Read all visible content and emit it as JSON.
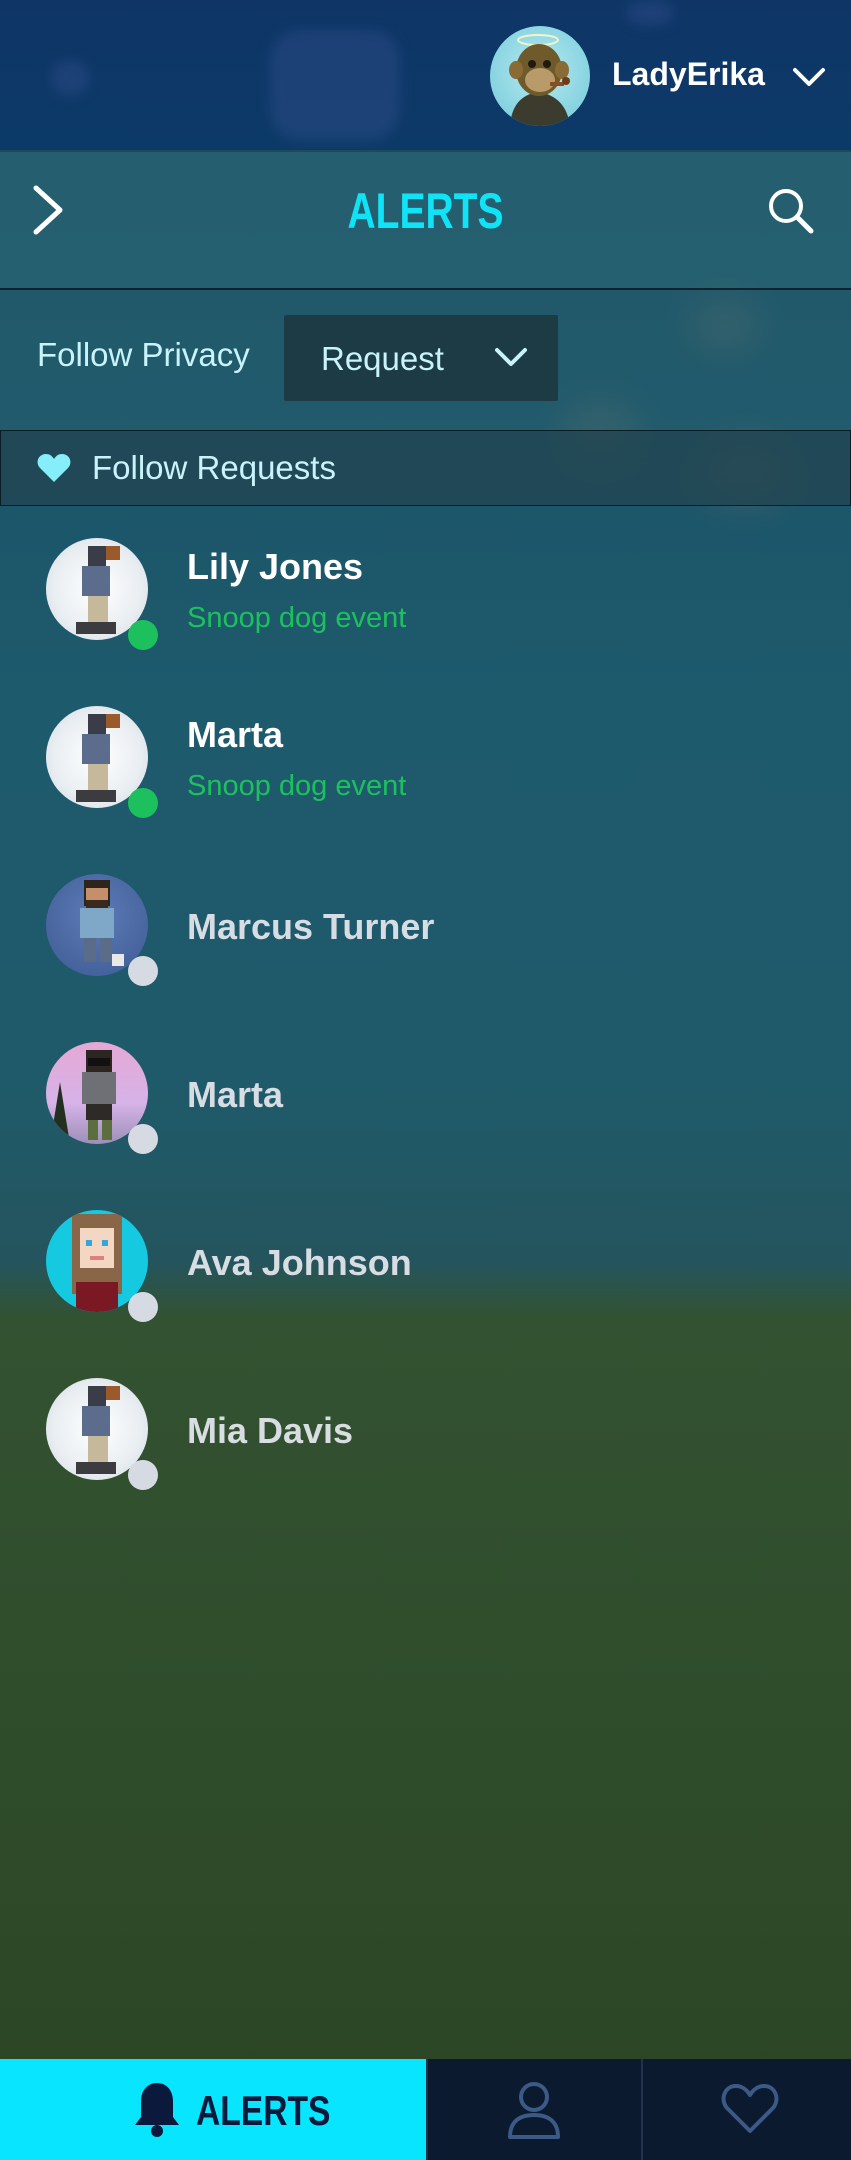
{
  "user": {
    "name": "LadyErika",
    "avatar_icon": "ape-avatar-icon"
  },
  "header": {
    "title": "ALERTS",
    "back_icon": "chevron-right-icon",
    "search_icon": "search-icon"
  },
  "privacy": {
    "label": "Follow Privacy",
    "selected": "Request"
  },
  "section": {
    "label": "Follow Requests",
    "icon": "heart-icon"
  },
  "items": [
    {
      "name": "Lily Jones",
      "subtitle": "Snoop dog event",
      "online": true
    },
    {
      "name": "Marta",
      "subtitle": "Snoop dog event",
      "online": true
    },
    {
      "name": "Marcus Turner",
      "subtitle": "",
      "online": false
    },
    {
      "name": "Marta",
      "subtitle": "",
      "online": false
    },
    {
      "name": "Ava Johnson",
      "subtitle": "",
      "online": false
    },
    {
      "name": "Mia Davis",
      "subtitle": "",
      "online": false
    }
  ],
  "nav": {
    "alerts_label": "ALERTS",
    "tabs": [
      "bell-icon",
      "profile-icon",
      "heart-icon"
    ]
  },
  "colors": {
    "accent": "#08e6ff",
    "online": "#1cc15e",
    "offline": "#d6dbe3",
    "subtitle": "#1cc15e"
  }
}
